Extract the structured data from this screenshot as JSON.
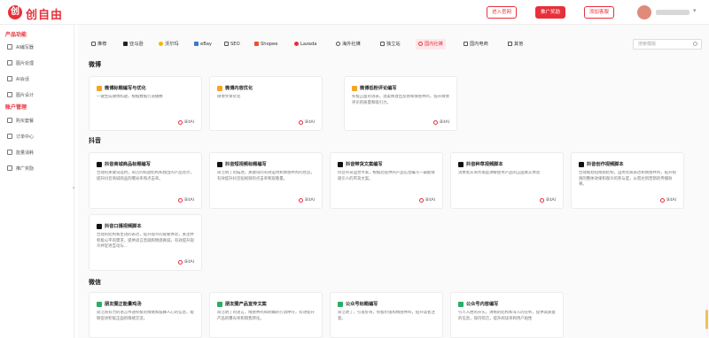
{
  "header": {
    "logo_mark": "创",
    "logo_text": "创自由",
    "btn1": "进入官网",
    "btn2": "推广奖励",
    "btn3": "添加客服",
    "caret": "▾"
  },
  "sidebar": {
    "sec1": "产品功能",
    "items1": [
      "AI编写器",
      "图片处理",
      "AI会话",
      "图片设计"
    ],
    "sec2": "账户管理",
    "items2": [
      "购买套餐",
      "订单中心",
      "能量消耗",
      "推广奖励"
    ],
    "collapse": "‹"
  },
  "tabs": [
    "推荐",
    "亚马逊",
    "沃尔玛",
    "eBay",
    "SEO",
    "Shopee",
    "Lazada",
    "海外社媒",
    "独立站",
    "国内社媒",
    "国内电商",
    "其他"
  ],
  "search": {
    "placeholder": "搜索模版"
  },
  "categories": {
    "weibo": "微博",
    "douyin": "抖音",
    "weixin": "微信"
  },
  "brand": "BitAI",
  "cards_weibo": [
    {
      "title": "微博标题编写与优化",
      "desc": "一键生成微博标题，根据数据行道播数"
    },
    {
      "title": "微博内容优化",
      "desc": "微博文章优化"
    },
    {
      "title": "微博低粉评论编写",
      "desc": "积极正面的语表，温柔释放出反感和情感共鸣，提升微博评论的质量和吸引力。"
    }
  ],
  "cards_douyin": [
    {
      "title": "抖音商城商品标题编写",
      "desc": "合理的关键词选用，简洁的标题结构和独出的产品亮点，提升抖音商城商品的曝光率和点击率。"
    },
    {
      "title": "抖音短视频标题编写",
      "desc": "简洁明了的描述，关键词的有效运用和情感共鸣的营造，有效提升抖音短视频的点击率和观看量。"
    },
    {
      "title": "抖音带货文案编写",
      "desc": "抖音带货运营专家，根据您提供的产品信息编写一篇能够吸引人的带货文案。"
    },
    {
      "title": "抖音种草视频脚本",
      "desc": "消费者从商务角度讲解使用产品的正面真实体验"
    },
    {
      "title": "抖音创作视频脚本",
      "desc": "合理规划短视频结构，运用优质表达和情感共鸣，提升视频的整体效果和观众的参与度，从而达到营销的传播效果。"
    },
    {
      "title": "抖音口播视频脚本",
      "desc": "合理的结构和生动的表达，提升观众的观看体验，关注并积极公平的需求，提供语言直观和情感真诚，有效提升观众并促进互动与..."
    }
  ],
  "cards_weixin": [
    {
      "title": "朋友圈正能量鸡汤",
      "desc": "简洁而有力的语言传递积极的情绪和鼓舞人心的信息，能够促进积极正面的情绪交流。"
    },
    {
      "title": "朋友圈产品宣传文案",
      "desc": "简洁明了的语言，情感共鸣和明确的行动呼吁，有效提升产品的曝光率和销售转化。"
    },
    {
      "title": "公众号标题编写",
      "desc": "简洁明了，引发好奇，积极价值和情感共鸣，提升读者注意。"
    },
    {
      "title": "公众号内容编写",
      "desc": "引人入胜的开头，清晰的结构和深入的分析，提供高质量的信息，保持简洁，提升阅读率和用户粘性"
    }
  ],
  "colors": {
    "accent": "#e8303a",
    "weibo_icon": "#f5a623",
    "douyin_icon": "#111111",
    "weixin_icon": "#2aae67"
  }
}
